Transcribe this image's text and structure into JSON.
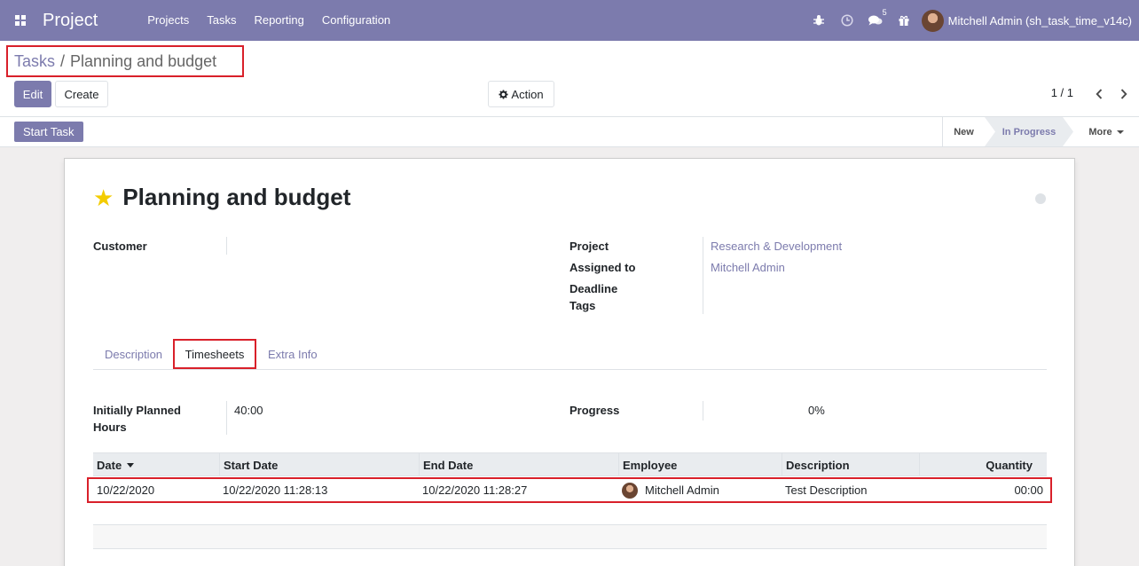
{
  "navbar": {
    "app_name": "Project",
    "menu": [
      "Projects",
      "Tasks",
      "Reporting",
      "Configuration"
    ],
    "messages_count": "5",
    "user_name": "Mitchell Admin (sh_task_time_v14c)",
    "icons": [
      "apps-icon",
      "bug-icon",
      "clock-icon",
      "chat-icon",
      "gift-icon"
    ]
  },
  "breadcrumb": {
    "parent": "Tasks",
    "separator": "/",
    "current": "Planning and budget"
  },
  "buttons": {
    "edit": "Edit",
    "create": "Create",
    "action": "Action"
  },
  "pager": {
    "value": "1 / 1"
  },
  "statusbar": {
    "start_task": "Start Task",
    "stages": {
      "new": "New",
      "in_progress": "In Progress",
      "more": "More"
    },
    "active_stage": "In Progress"
  },
  "task": {
    "title": "Planning and budget",
    "starred": true,
    "fields": {
      "customer_label": "Customer",
      "customer_value": "",
      "project_label": "Project",
      "project_value": "Research & Development",
      "assigned_label": "Assigned to",
      "assigned_value": "Mitchell Admin",
      "deadline_label": "Deadline",
      "tags_label": "Tags"
    }
  },
  "tabs": {
    "description": "Description",
    "timesheets": "Timesheets",
    "extra_info": "Extra Info",
    "active": "Timesheets"
  },
  "timesheet_summary": {
    "planned_label_1": "Initially Planned",
    "planned_label_2": "Hours",
    "planned_value": "40:00",
    "progress_label": "Progress",
    "progress_value": "0%"
  },
  "timesheet_table": {
    "columns": {
      "date": "Date",
      "start_date": "Start Date",
      "end_date": "End Date",
      "employee": "Employee",
      "description": "Description",
      "quantity": "Quantity"
    },
    "rows": [
      {
        "date": "10/22/2020",
        "start_date": "10/22/2020 11:28:13",
        "end_date": "10/22/2020 11:28:27",
        "employee": "Mitchell Admin",
        "description": "Test Description",
        "quantity": "00:00"
      }
    ]
  },
  "colors": {
    "brand": "#7c7bad",
    "highlight": "#d9202a",
    "star": "#f3cc00"
  }
}
